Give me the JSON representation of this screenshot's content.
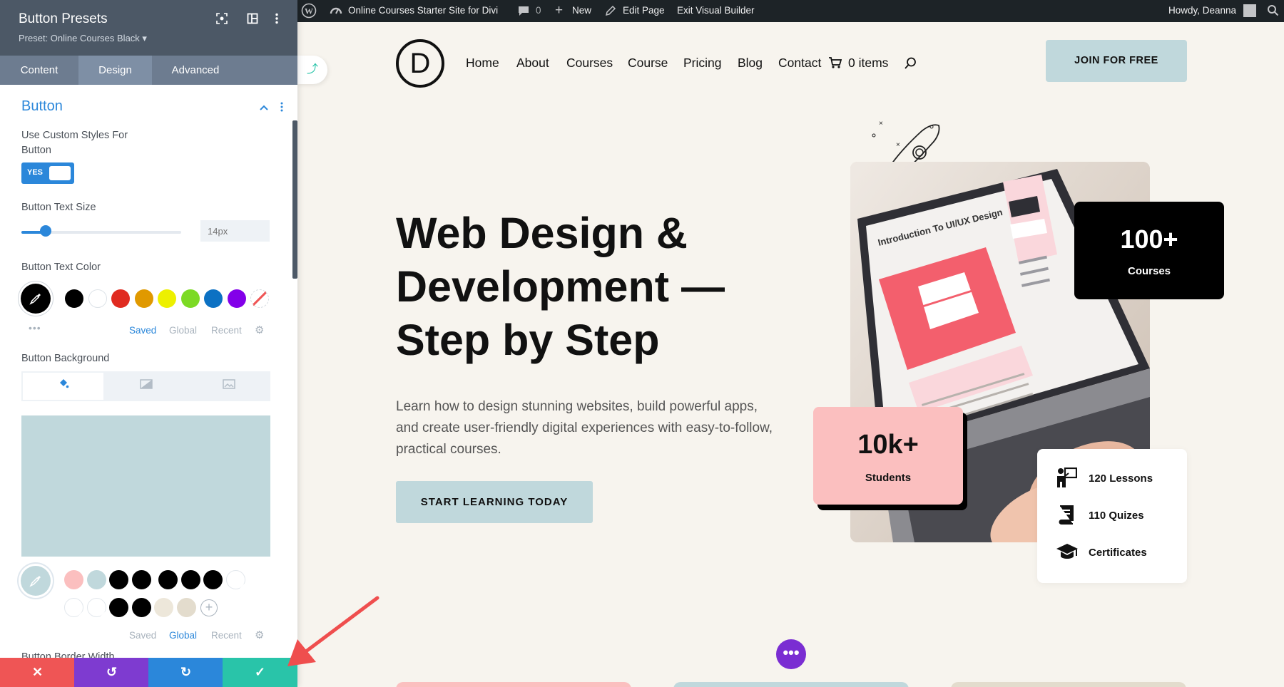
{
  "panel": {
    "title": "Button Presets",
    "preset": "Preset: Online Courses Black ▾",
    "head_icons": [
      "focus-icon",
      "layout-icon",
      "kebab-icon"
    ],
    "tabs": [
      "Content",
      "Design",
      "Advanced"
    ],
    "active_tab": "Design",
    "section_title": "Button",
    "custom_styles_label": "Use Custom Styles For Button",
    "toggle_value": "YES",
    "text_size_label": "Button Text Size",
    "text_size_placeholder": "14px",
    "text_size_slider_fraction": 0.15,
    "text_color_label": "Button Text Color",
    "text_color_swatches": [
      "#000000",
      "#ffffff",
      "#e02b20",
      "#e09900",
      "#edf000",
      "#7cda24",
      "#0c71c3",
      "#8300e9",
      "none"
    ],
    "color_tabs": [
      "Saved",
      "Global",
      "Recent"
    ],
    "text_color_active_tab": "Saved",
    "bg_label": "Button Background",
    "bg_tabs": [
      "color-fill-icon",
      "gradient-icon",
      "image-icon"
    ],
    "bg_color": "#c0d8dc",
    "bg_swatches_row1": [
      "#fbbfbf",
      "#c0d8dc",
      "#000000",
      "#000000",
      "#000000",
      "#000000",
      "#000000",
      "#ffffff"
    ],
    "bg_swatches_row2": [
      "#ffffff",
      "#ffffff",
      "#000000",
      "#000000",
      "#ede7da",
      "#e3dccd"
    ],
    "bg_color_active_tab": "Global",
    "next_label": "Button Border Width",
    "actions": [
      "close-icon",
      "undo-icon",
      "redo-icon",
      "check-icon"
    ],
    "action_colors": [
      "#ef5555",
      "#7e3bd0",
      "#2b87da",
      "#29c4a9"
    ]
  },
  "admin_bar": {
    "site_name": "Online Courses Starter Site for Divi",
    "comments": "0",
    "new": "New",
    "edit_page": "Edit Page",
    "exit": "Exit Visual Builder",
    "howdy": "Howdy, Deanna"
  },
  "site": {
    "logo_letter": "D",
    "nav": [
      "Home",
      "About",
      "Courses",
      "Course",
      "Pricing",
      "Blog",
      "Contact"
    ],
    "cart": "0 items",
    "join": "JOIN FOR FREE",
    "hero_title": "Web Design & Development — Step by Step",
    "hero_text": "Learn how to design stunning websites, build powerful apps, and create user-friendly digital experiences with easy-to-follow, practical courses.",
    "cta": "START LEARNING TODAY",
    "stat_courses_num": "100+",
    "stat_courses_label": "Courses",
    "stat_students_num": "10k+",
    "stat_students_label": "Students",
    "features": [
      "120 Lessons",
      "110 Quizes",
      "Certificates"
    ],
    "screen_heading": "Introduction To UI/UX Design",
    "dots": "•••"
  },
  "colors": {
    "accent_blue": "#2b87da",
    "button_bg": "#c0d8dc",
    "pink": "#fbbfbf",
    "page_bg": "#f7f4ee"
  }
}
